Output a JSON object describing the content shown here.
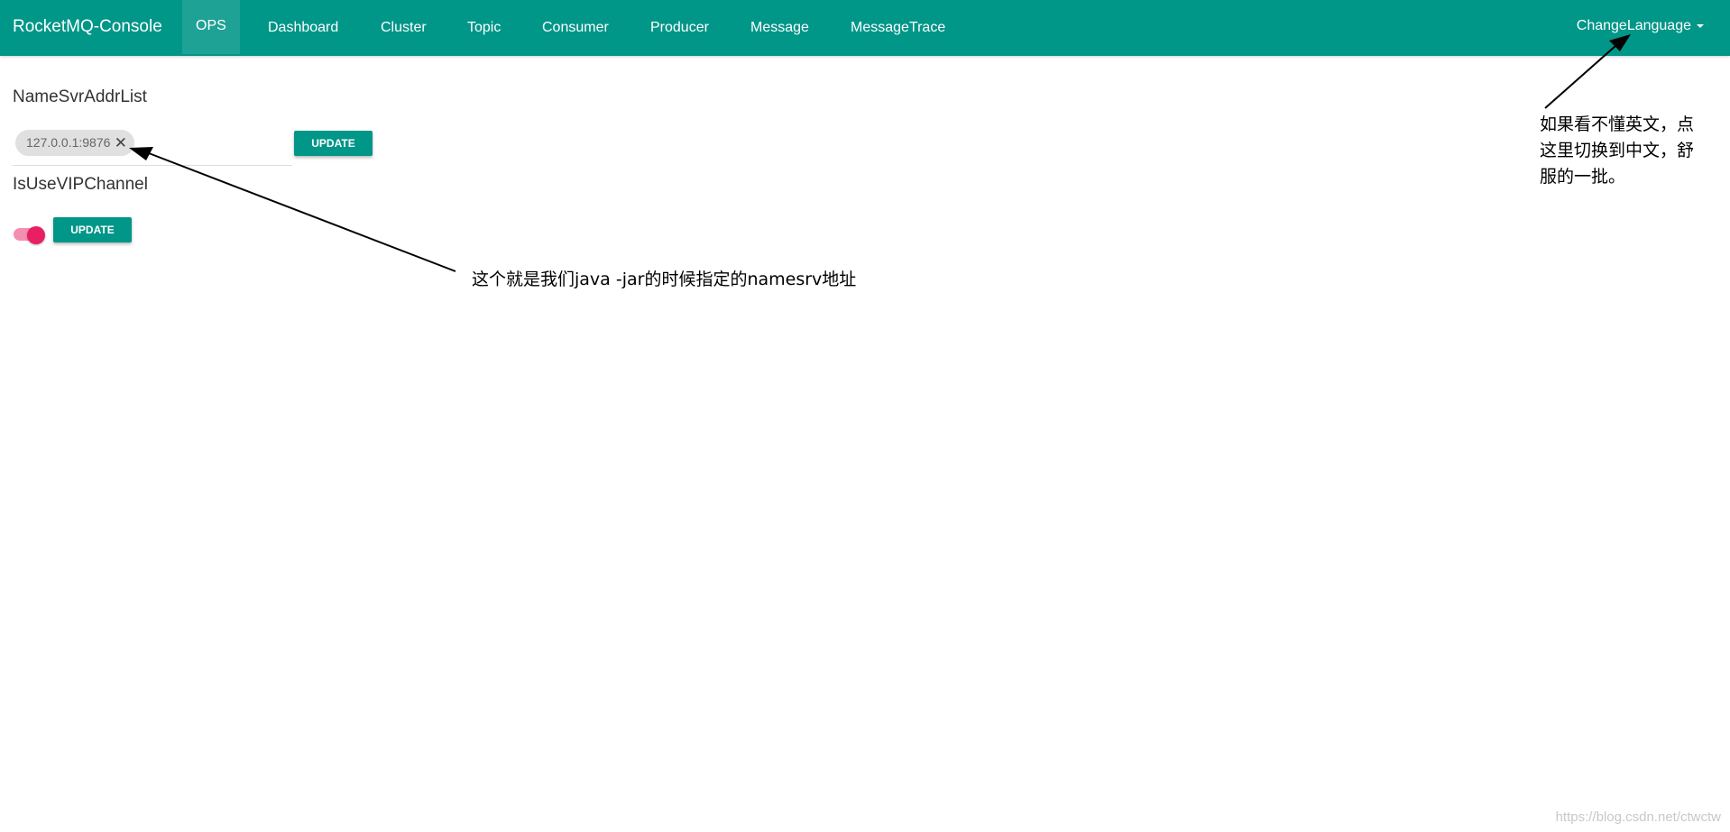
{
  "navbar": {
    "brand": "RocketMQ-Console",
    "items": [
      "OPS",
      "Dashboard",
      "Cluster",
      "Topic",
      "Consumer",
      "Producer",
      "Message",
      "MessageTrace"
    ],
    "language_label": "ChangeLanguage"
  },
  "main": {
    "namesrv_label": "NameSvrAddrList",
    "namesrv_chip": "127.0.0.1:9876",
    "update_label": "UPDATE",
    "vip_label": "IsUseVIPChannel",
    "vip_enabled": true
  },
  "annotations": {
    "namesrv_note": "这个就是我们java -jar的时候指定的namesrv地址",
    "language_note_lines": [
      "如果看不懂英文，点",
      "这里切换到中文，舒",
      "服的一批。"
    ]
  },
  "colors": {
    "accent": "#009688",
    "toggle_knob": "#e91e63",
    "toggle_track": "#f48fb1"
  },
  "footer": {
    "watermark": "https://blog.csdn.net/ctwctw"
  }
}
